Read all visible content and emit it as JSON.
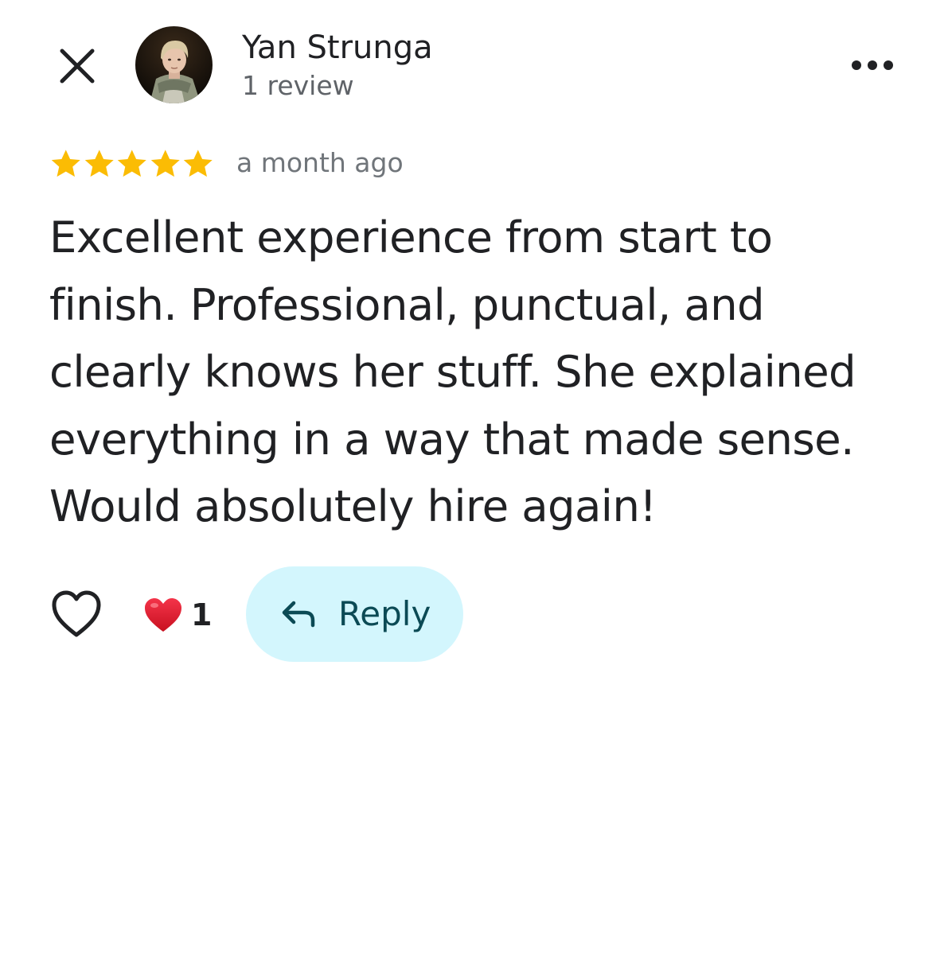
{
  "header": {
    "close_icon": "close-icon",
    "more_icon": "more-horizontal-icon"
  },
  "reviewer": {
    "name": "Yan Strunga",
    "meta": "1 review",
    "avatar_icon": "profile-photo"
  },
  "review": {
    "rating": 5,
    "rating_max": 5,
    "star_color": "#fbbc04",
    "time": "a month ago",
    "text": "Excellent experience from start to finish. Professional, punctual, and clearly knows her stuff. She explained everything in a way that made sense. Would absolutely hire again!"
  },
  "actions": {
    "like_icon": "heart-outline-icon",
    "reaction_icon": "red-heart-emoji",
    "reaction_count": "1",
    "reply_label": "Reply",
    "reply_icon": "reply-arrow-icon",
    "reply_bg_color": "#d3f6fd"
  }
}
